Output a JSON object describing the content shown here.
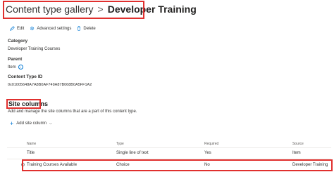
{
  "breadcrumb": {
    "root": "Content type gallery",
    "separator": ">",
    "current": "Developer Training"
  },
  "commands": {
    "edit": "Edit",
    "advanced": "Advanced settings",
    "delete": "Delete"
  },
  "details": {
    "category_label": "Category",
    "category_value": "Developer Training Courses",
    "parent_label": "Parent",
    "parent_value": "Item",
    "ctid_label": "Content Type ID",
    "ctid_value": "0x01005648A7A8B0AF749A87B068B0A5FF1A2"
  },
  "site_columns": {
    "title": "Site columns",
    "description": "Add and manage the site columns that are a part of this content type.",
    "add_label": "Add site column",
    "headers": {
      "name": "Name",
      "type": "Type",
      "required": "Required",
      "source": "Source"
    },
    "rows": [
      {
        "name": "Title",
        "type": "Single line of text",
        "required": "Yes",
        "source": "Item"
      },
      {
        "name": "Training Courses Available",
        "type": "Choice",
        "required": "No",
        "source": "Developer Training"
      }
    ]
  },
  "colors": {
    "accent": "#0078d4",
    "highlight": "#e0302e"
  }
}
